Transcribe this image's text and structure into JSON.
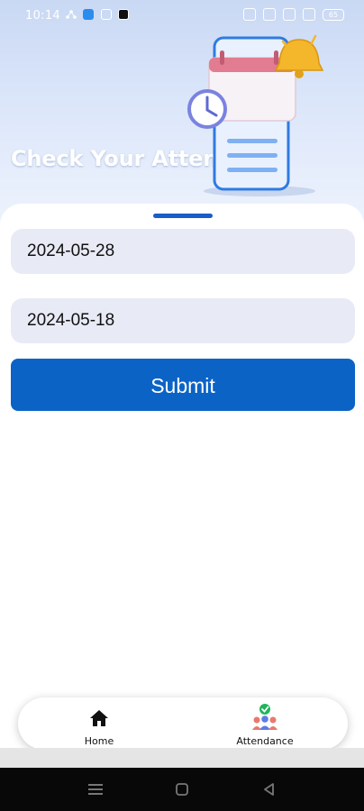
{
  "status_bar": {
    "time": "10:14",
    "battery": "65"
  },
  "header": {
    "title": "Check Your Attendance"
  },
  "form": {
    "start_date_value": "2024-05-28",
    "end_date_value": "2024-05-18",
    "submit_label": "Submit"
  },
  "bottom_nav": {
    "items": [
      {
        "label": "Home",
        "icon": "home-icon"
      },
      {
        "label": "Attendance",
        "icon": "attendance-group-icon"
      }
    ]
  },
  "colors": {
    "primary": "#0b63c6",
    "field_bg": "#e8ebf5",
    "hero_bg": "#c9d8f3"
  }
}
